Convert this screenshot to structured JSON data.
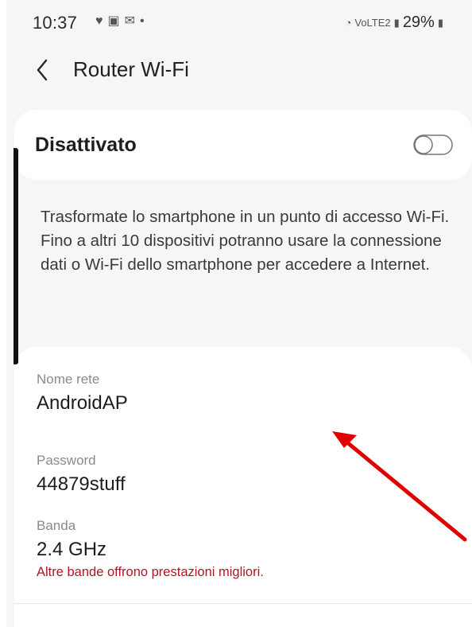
{
  "status_bar": {
    "time": "10:37",
    "notification_icons": [
      "heart-pulse-icon",
      "message-icon",
      "mail-icon",
      "dot-icon"
    ],
    "right_icons": [
      "wifi-icon",
      "volte-lte-icon",
      "signal-icon"
    ],
    "volte_text": "VoLTE2",
    "battery_text": "29%"
  },
  "header": {
    "title": "Router Wi-Fi",
    "back_icon": "chevron-left-icon"
  },
  "toggle_card": {
    "label": "Disattivato",
    "switch_state": "off"
  },
  "description": {
    "text": "Trasformate lo smartphone in un punto di accesso Wi-Fi. Fino a altri 10 dispositivi potranno usare la connessione dati o Wi-Fi dello smartphone per accedere a Internet."
  },
  "settings": {
    "network_name": {
      "label": "Nome rete",
      "value": "AndroidAP"
    },
    "password": {
      "label": "Password",
      "value": "44879stuff"
    },
    "band": {
      "label": "Banda",
      "value": "2.4 GHz",
      "warning": "Altre bande offrono prestazioni migliori."
    }
  },
  "colors": {
    "background": "#f6f6f6",
    "card": "#ffffff",
    "warning": "#b01526",
    "annotation_arrow": "#e00000"
  }
}
